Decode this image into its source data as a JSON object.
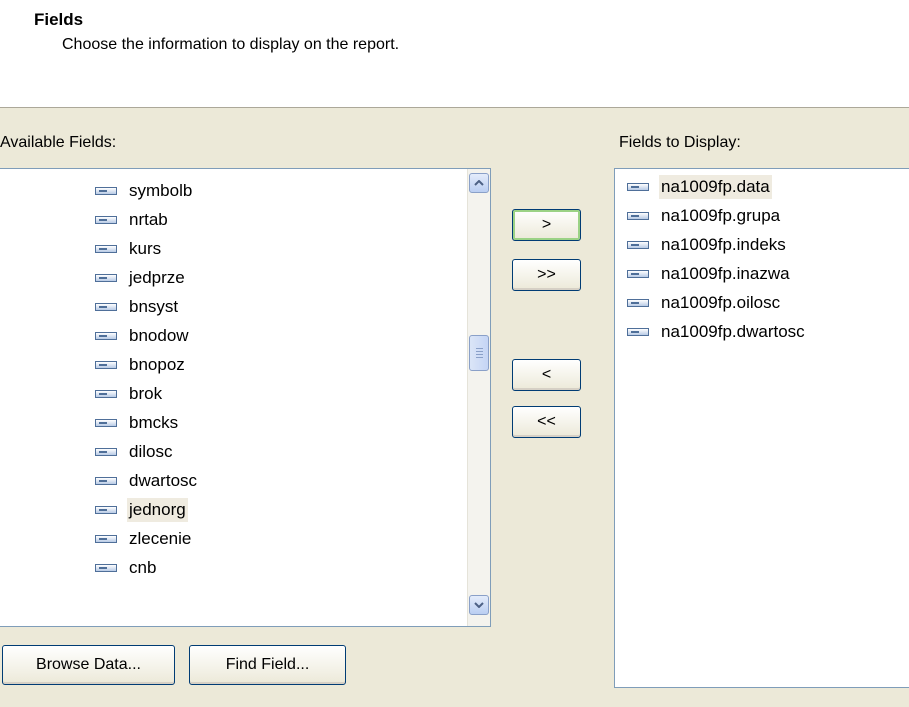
{
  "header": {
    "title": "Fields",
    "subtitle": "Choose the information to display on the report."
  },
  "available": {
    "label": "Available Fields:",
    "items": [
      "symbolb",
      "nrtab",
      "kurs",
      "jedprze",
      "bnsyst",
      "bnodow",
      "bnopoz",
      "brok",
      "bmcks",
      "dilosc",
      "dwartosc",
      "jednorg",
      "zlecenie",
      "cnb"
    ],
    "selected_index": 11
  },
  "display": {
    "label": "Fields to Display:",
    "items": [
      "na1009fp.data",
      "na1009fp.grupa",
      "na1009fp.indeks",
      "na1009fp.inazwa",
      "na1009fp.oilosc",
      "na1009fp.dwartosc"
    ],
    "selected_index": 0
  },
  "buttons": {
    "add": ">",
    "add_all": ">>",
    "remove": "<",
    "remove_all": "<<",
    "browse_data": "Browse Data...",
    "find_field": "Find Field..."
  },
  "colors": {
    "panel": "#ece9d8",
    "header_bg": "#ffffff",
    "list_border": "#7f9db9",
    "selection": "#efebe0"
  }
}
